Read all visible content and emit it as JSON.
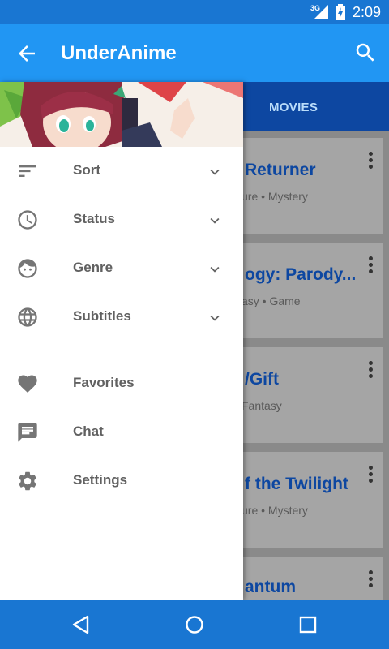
{
  "status_bar": {
    "network": "3G",
    "time": "2:09"
  },
  "app_bar": {
    "title": "UnderAnime"
  },
  "tabs": {
    "movies": "MOVIES"
  },
  "cards": [
    {
      "title": "Returner",
      "subtitle": "ure • Mystery"
    },
    {
      "title": "ogy: Parody...",
      "subtitle": "asy • Game"
    },
    {
      "title": "/Gift",
      "subtitle": "Fantasy"
    },
    {
      "title": "f the Twilight",
      "subtitle": "ure • Mystery"
    },
    {
      "title": "antum",
      "subtitle": ""
    }
  ],
  "drawer": {
    "filters": [
      {
        "label": "Sort",
        "icon": "sort-icon"
      },
      {
        "label": "Status",
        "icon": "clock-icon"
      },
      {
        "label": "Genre",
        "icon": "face-icon"
      },
      {
        "label": "Subtitles",
        "icon": "globe-icon"
      }
    ],
    "links": [
      {
        "label": "Favorites",
        "icon": "heart-icon"
      },
      {
        "label": "Chat",
        "icon": "chat-icon"
      },
      {
        "label": "Settings",
        "icon": "gear-icon"
      }
    ]
  },
  "colors": {
    "primary": "#2196f3",
    "primary_dark": "#1976d2",
    "tab_bar": "#0d47a1",
    "card_title": "#0d47a1"
  }
}
